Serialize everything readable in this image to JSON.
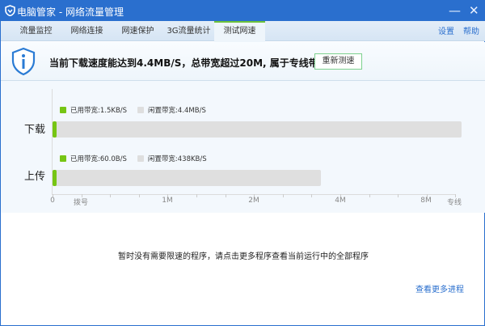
{
  "window": {
    "title": "电脑管家 - 网络流量管理",
    "minimize": "—",
    "close": "✕"
  },
  "tabs": [
    {
      "label": "流量监控"
    },
    {
      "label": "网络连接"
    },
    {
      "label": "网速保护"
    },
    {
      "label": "3G流量统计"
    },
    {
      "label": "测试网速",
      "active": true
    }
  ],
  "links": {
    "settings": "设置",
    "help": "帮助"
  },
  "banner": {
    "message": "当前下载速度能达到4.4MB/S，总带宽超过20M, 属于专线带宽",
    "retest": "重新测速"
  },
  "chart_data": {
    "type": "bar",
    "orientation": "horizontal",
    "categories": [
      "下载",
      "上传"
    ],
    "download": {
      "label": "下载",
      "used": "已用带宽:1.5KB/S",
      "idle": "闲置带宽:4.4MB/S"
    },
    "upload": {
      "label": "上传",
      "used": "已用带宽:60.0B/S",
      "idle": "闲置带宽:438KB/S"
    },
    "ticks": [
      "0",
      "拨号",
      "1M",
      "2M",
      "4M",
      "8M",
      "专线"
    ],
    "colors": {
      "used": "#76c514",
      "idle": "#dfdfdf"
    }
  },
  "footer": {
    "note": "暂时没有需要限速的程序，请点击更多程序查看当前运行中的全部程序",
    "more": "查看更多进程"
  }
}
